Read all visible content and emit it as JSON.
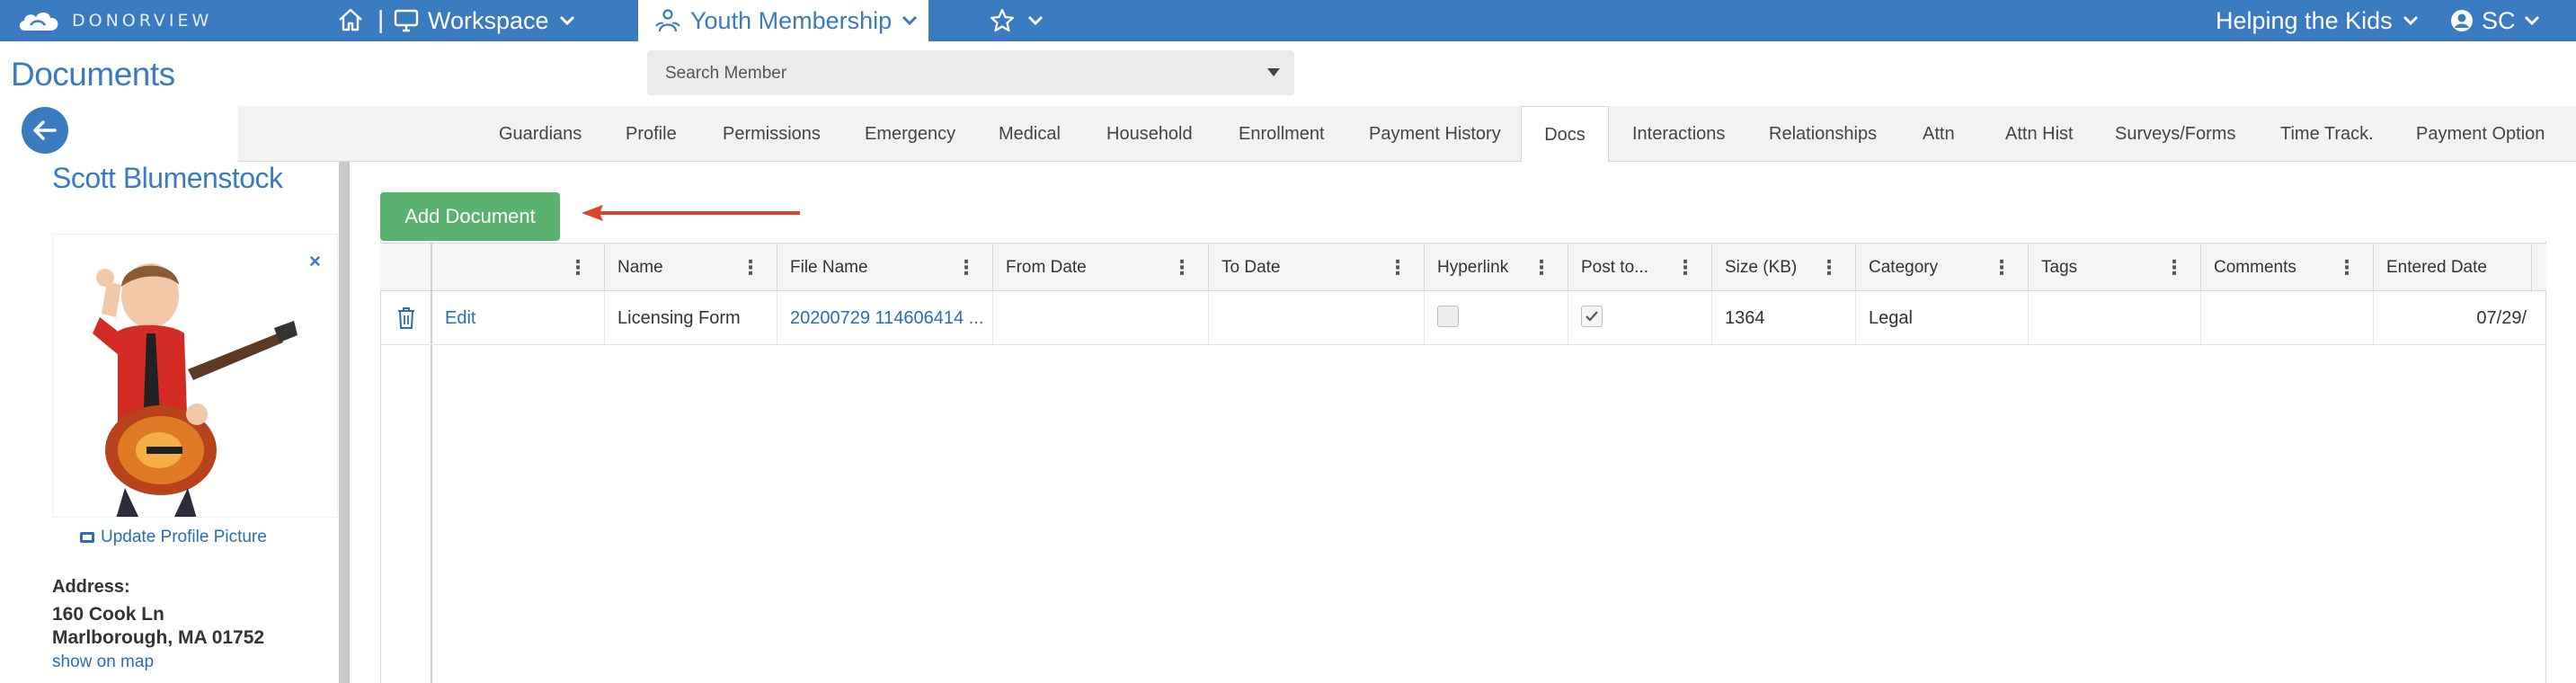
{
  "topbar": {
    "logo_text": "DONORVIEW",
    "workspace_label": "Workspace",
    "active_module": "Youth Membership",
    "org_name": "Helping the Kids",
    "user_initials": "SC",
    "accent_color": "#3a7bbf"
  },
  "header": {
    "page_title": "Documents",
    "search_placeholder": "Search Member"
  },
  "tabs": [
    {
      "label": "Guardians"
    },
    {
      "label": "Profile"
    },
    {
      "label": "Permissions"
    },
    {
      "label": "Emergency"
    },
    {
      "label": "Medical"
    },
    {
      "label": "Household"
    },
    {
      "label": "Enrollment"
    },
    {
      "label": "Payment History"
    },
    {
      "label": "Docs",
      "active": true
    },
    {
      "label": "Interactions"
    },
    {
      "label": "Relationships"
    },
    {
      "label": "Attn"
    },
    {
      "label": "Attn Hist"
    },
    {
      "label": "Surveys/Forms"
    },
    {
      "label": "Time Track."
    },
    {
      "label": "Payment Option"
    }
  ],
  "profile": {
    "name": "Scott Blumenstock",
    "close_glyph": "×",
    "update_picture": "Update Profile Picture",
    "address_label": "Address:",
    "address_line1": "160 Cook Ln",
    "address_line2": "Marlborough, MA 01752",
    "map_link": "show on map"
  },
  "documents": {
    "add_button": "Add Document",
    "columns": [
      "Name",
      "File Name",
      "From Date",
      "To Date",
      "Hyperlink",
      "Post to...",
      "Size (KB)",
      "Category",
      "Tags",
      "Comments",
      "Entered Date"
    ],
    "rows": [
      {
        "edit": "Edit",
        "name": "Licensing Form",
        "file_name": "20200729 114606414 ...",
        "from_date": "",
        "to_date": "",
        "hyperlink": false,
        "post_to": true,
        "size_kb": "1364",
        "category": "Legal",
        "tags": "",
        "comments": "",
        "entered_date": "07/29/"
      }
    ],
    "add_button_color": "#5bb26f",
    "arrow_color": "#e0412b"
  }
}
